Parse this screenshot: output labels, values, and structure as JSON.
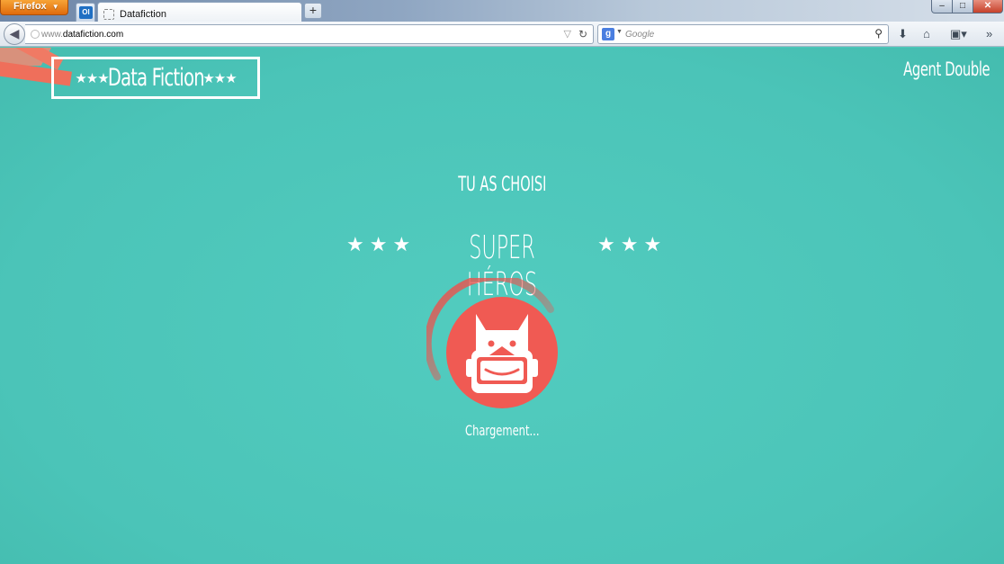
{
  "browser": {
    "menu_button": "Firefox",
    "tab_title": "Datafiction",
    "app_tab_label": "Ol",
    "new_tab": "+",
    "url_prefix": "www.",
    "url_domain": "datafiction.com",
    "search_placeholder": "Google",
    "search_engine_letter": "g"
  },
  "page": {
    "logo_stars_left": "★★★",
    "logo_text": "Data Fiction",
    "logo_stars_right": "★★★",
    "agent_link": "Agent Double",
    "chose_text": "TU AS CHOISI",
    "hero_stars": "★★★",
    "hero_name": "SUPER HÉROS",
    "loading_text": "Chargement..."
  },
  "colors": {
    "background": "#4ec9bc",
    "accent_coral": "#f05a53",
    "progress_ring": "#e85550"
  },
  "progress": {
    "fraction": 0.42
  }
}
